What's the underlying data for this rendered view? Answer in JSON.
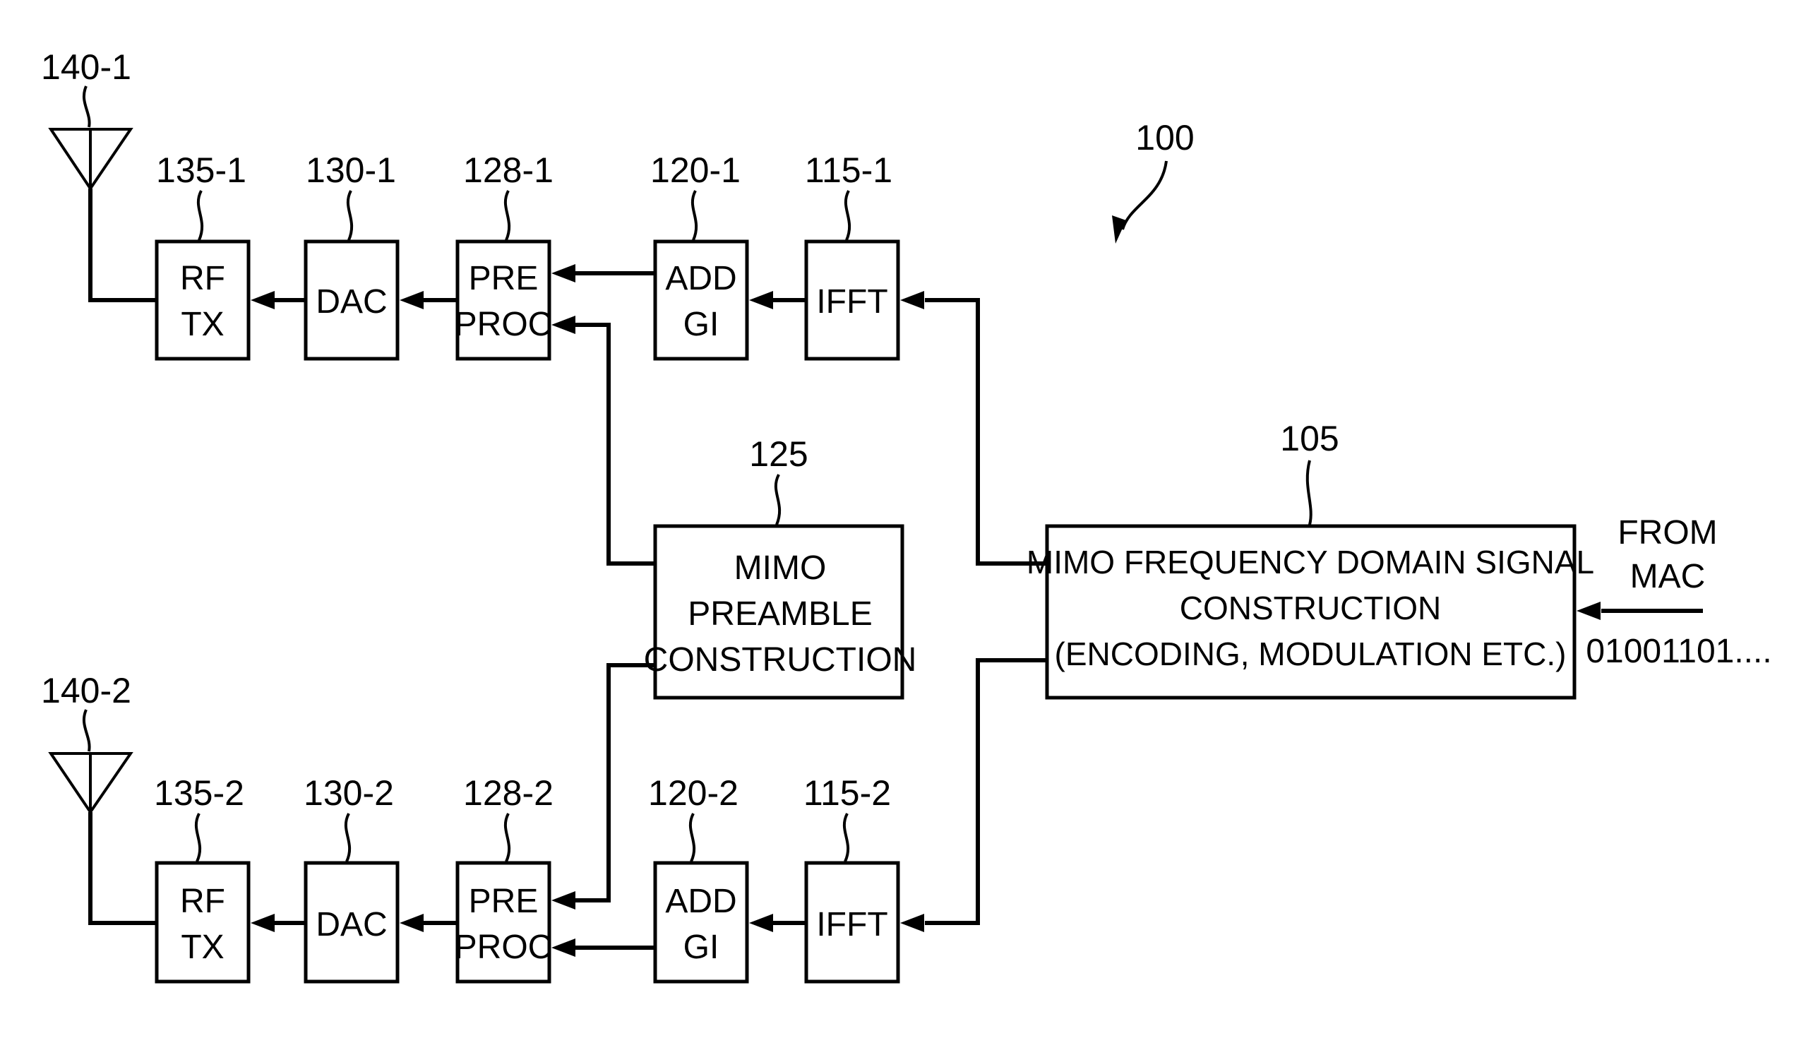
{
  "figure": {
    "ref": "100",
    "chains": [
      {
        "antenna_ref": "140-1",
        "rftx": {
          "ref": "135-1",
          "lines": [
            "RF",
            "TX"
          ]
        },
        "dac": {
          "ref": "130-1",
          "lines": [
            "DAC"
          ]
        },
        "preproc": {
          "ref": "128-1",
          "lines": [
            "PRE",
            "PROC"
          ]
        },
        "addgi": {
          "ref": "120-1",
          "lines": [
            "ADD",
            "GI"
          ]
        },
        "ifft": {
          "ref": "115-1",
          "lines": [
            "IFFT"
          ]
        }
      },
      {
        "antenna_ref": "140-2",
        "rftx": {
          "ref": "135-2",
          "lines": [
            "RF",
            "TX"
          ]
        },
        "dac": {
          "ref": "130-2",
          "lines": [
            "DAC"
          ]
        },
        "preproc": {
          "ref": "128-2",
          "lines": [
            "PRE",
            "PROC"
          ]
        },
        "addgi": {
          "ref": "120-2",
          "lines": [
            "ADD",
            "GI"
          ]
        },
        "ifft": {
          "ref": "115-2",
          "lines": [
            "IFFT"
          ]
        }
      }
    ],
    "preamble": {
      "ref": "125",
      "lines": [
        "MIMO",
        "PREAMBLE",
        "CONSTRUCTION"
      ]
    },
    "freq_domain": {
      "ref": "105",
      "lines": [
        "MIMO FREQUENCY DOMAIN SIGNAL",
        "CONSTRUCTION",
        "(ENCODING, MODULATION ETC.)"
      ]
    },
    "input": {
      "lines": [
        "FROM",
        "MAC"
      ],
      "bits": "01001101...."
    }
  }
}
